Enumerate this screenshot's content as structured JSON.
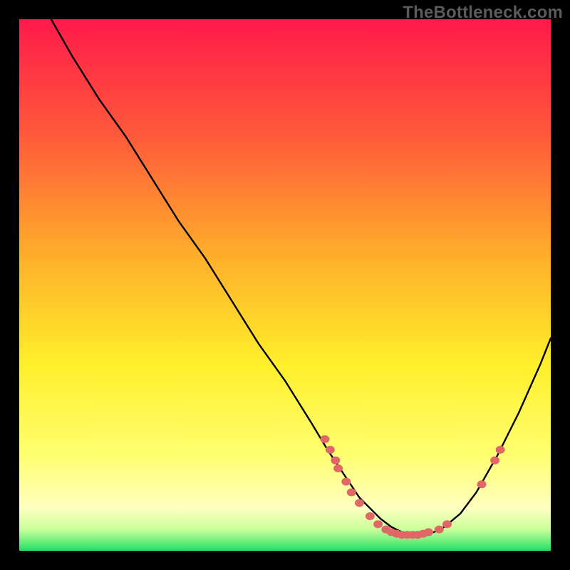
{
  "watermark": "TheBottleneck.com",
  "colors": {
    "page_bg": "#000000",
    "watermark": "#5b5b5b",
    "curve": "#000000",
    "marker": "#e06766",
    "gradient_top": "#ff1a4b",
    "gradient_mid_upper": "#ff8f2c",
    "gradient_mid": "#fff02a",
    "gradient_lower": "#ffff9a",
    "gradient_bottom": "#22ee66"
  },
  "chart_data": {
    "type": "line",
    "title": "",
    "xlabel": "",
    "ylabel": "",
    "xlim": [
      0,
      100
    ],
    "ylim": [
      0,
      100
    ],
    "series": [
      {
        "name": "bottleneck-curve",
        "x": [
          6,
          10,
          15,
          20,
          25,
          30,
          35,
          40,
          45,
          50,
          55,
          58,
          60,
          62,
          64,
          66,
          68,
          70,
          72,
          74,
          76,
          78,
          80,
          83,
          86,
          90,
          94,
          98,
          100
        ],
        "y": [
          100,
          93,
          85,
          78,
          70,
          62,
          55,
          47,
          39,
          32,
          24,
          19,
          16,
          13,
          10,
          8,
          6,
          4.5,
          3.5,
          3,
          3,
          3.5,
          4.5,
          7,
          11,
          18,
          26,
          35,
          40
        ]
      }
    ],
    "markers": [
      {
        "x": 57.5,
        "y": 21
      },
      {
        "x": 58.5,
        "y": 19
      },
      {
        "x": 59.5,
        "y": 17
      },
      {
        "x": 60.0,
        "y": 15.5
      },
      {
        "x": 61.5,
        "y": 13
      },
      {
        "x": 62.5,
        "y": 11
      },
      {
        "x": 64.0,
        "y": 9
      },
      {
        "x": 66.0,
        "y": 6.5
      },
      {
        "x": 67.5,
        "y": 5
      },
      {
        "x": 69.0,
        "y": 4
      },
      {
        "x": 70.0,
        "y": 3.5
      },
      {
        "x": 71.0,
        "y": 3.2
      },
      {
        "x": 72.0,
        "y": 3
      },
      {
        "x": 73.0,
        "y": 3
      },
      {
        "x": 74.0,
        "y": 3
      },
      {
        "x": 75.0,
        "y": 3
      },
      {
        "x": 76.0,
        "y": 3.2
      },
      {
        "x": 77.0,
        "y": 3.5
      },
      {
        "x": 79.0,
        "y": 4
      },
      {
        "x": 80.5,
        "y": 5
      },
      {
        "x": 87.0,
        "y": 12.5
      },
      {
        "x": 89.5,
        "y": 17
      },
      {
        "x": 90.5,
        "y": 19
      }
    ]
  }
}
